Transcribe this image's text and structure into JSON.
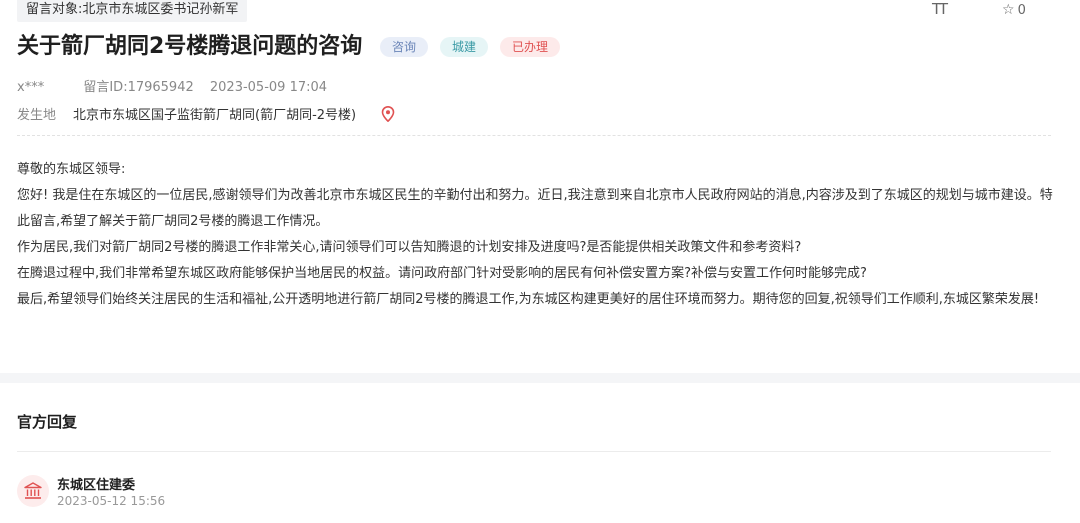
{
  "message": {
    "target_label": "留言对象:北京市东城区委书记孙新军",
    "font_size_icon_text": "TT",
    "star_count": "0",
    "title": "关于箭厂胡同2号楼腾退问题的咨询",
    "tags": [
      "咨询",
      "城建",
      "已办理"
    ],
    "author": "x***",
    "message_id": "留言ID:17965942",
    "datetime": "2023-05-09 17:04",
    "location_label": "发生地",
    "location_value": "北京市东城区国子监街箭厂胡同(箭厂胡同-2号楼)",
    "paragraphs": [
      "尊敬的东城区领导:",
      "您好! 我是住在东城区的一位居民,感谢领导们为改善北京市东城区民生的辛勤付出和努力。近日,我注意到来自北京市人民政府网站的消息,内容涉及到了东城区的规划与城市建设。特此留言,希望了解关于箭厂胡同2号楼的腾退工作情况。",
      "作为居民,我们对箭厂胡同2号楼的腾退工作非常关心,请问领导们可以告知腾退的计划安排及进度吗?是否能提供相关政策文件和参考资料?",
      "在腾退过程中,我们非常希望东城区政府能够保护当地居民的权益。请问政府部门针对受影响的居民有何补偿安置方案?补偿与安置工作何时能够完成?",
      "最后,希望领导们始终关注居民的生活和福祉,公开透明地进行箭厂胡同2号楼的腾退工作,为东城区构建更美好的居住环境而努力。期待您的回复,祝领导们工作顺利,东城区繁荣发展!"
    ]
  },
  "reply": {
    "section_title": "官方回复",
    "department": "东城区住建委",
    "datetime": "2023-05-12 15:56"
  },
  "colors": {
    "tag_consult": "#6b86b8",
    "tag_construction": "#3a9aa5",
    "tag_done": "#e05252",
    "pin": "#e05252"
  },
  "icons": [
    "font-size-icon",
    "star-icon",
    "location-pin-icon",
    "government-building-icon"
  ]
}
